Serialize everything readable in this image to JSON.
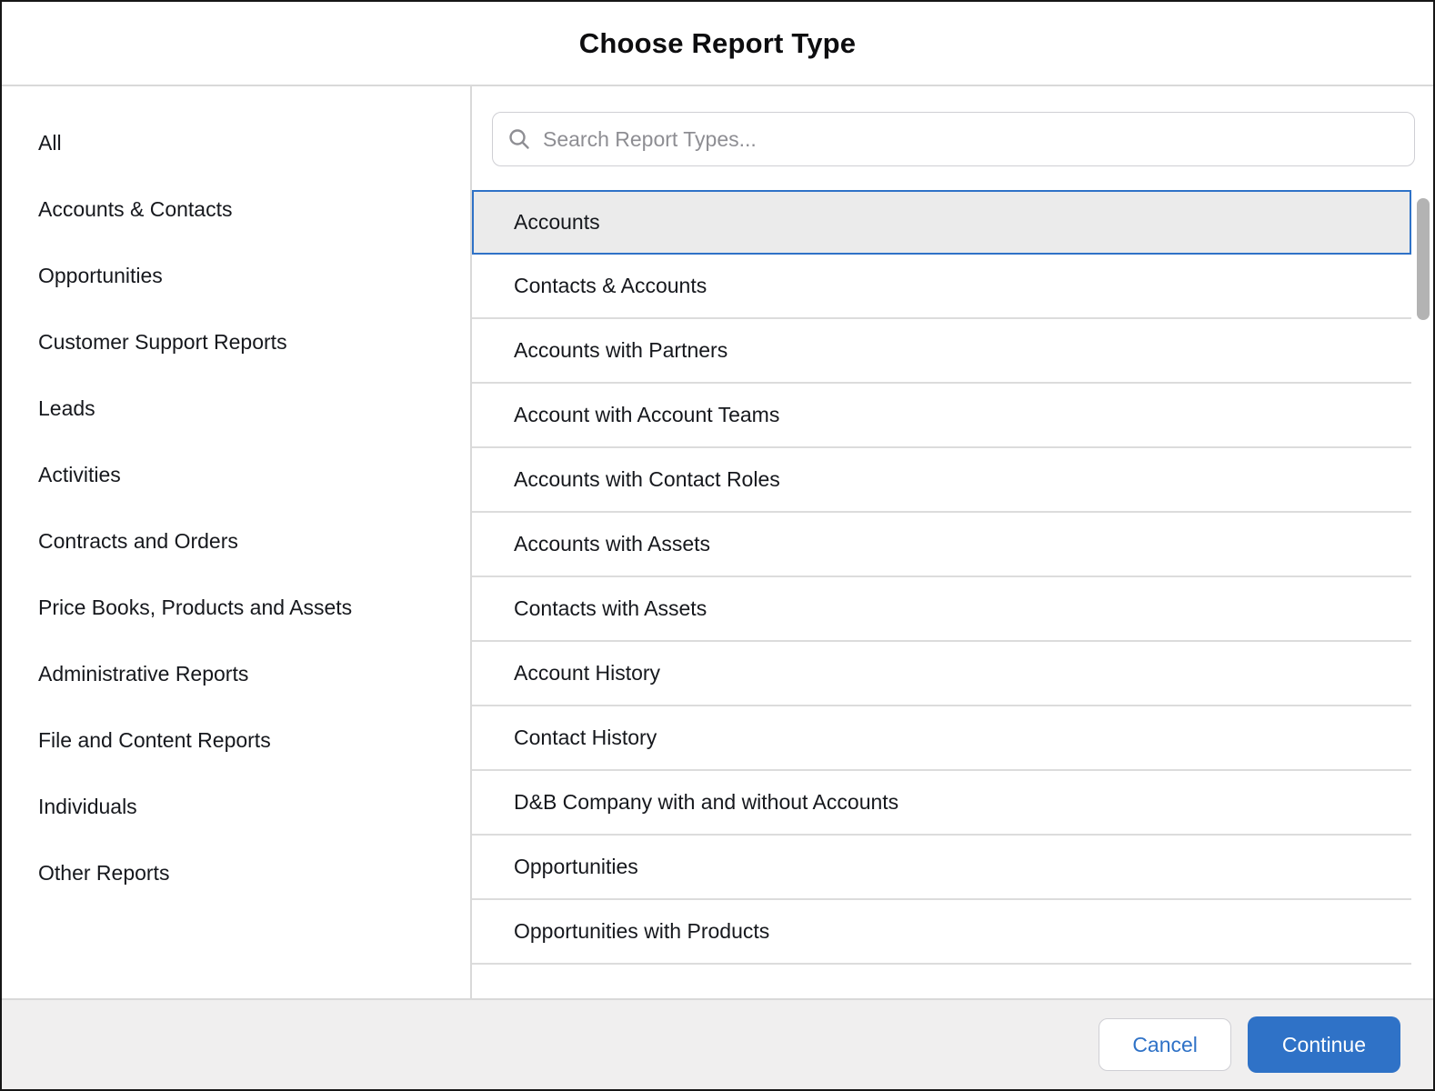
{
  "modal": {
    "title": "Choose Report Type"
  },
  "sidebar": {
    "items": [
      "All",
      "Accounts & Contacts",
      "Opportunities",
      "Customer Support Reports",
      "Leads",
      "Activities",
      "Contracts and Orders",
      "Price Books, Products and Assets",
      "Administrative Reports",
      "File and Content Reports",
      "Individuals",
      "Other Reports"
    ]
  },
  "search": {
    "placeholder": "Search Report Types...",
    "icon": "search-icon",
    "value": ""
  },
  "report_list": {
    "selected_index": 0,
    "items": [
      "Accounts",
      "Contacts & Accounts",
      "Accounts with Partners",
      "Account with Account Teams",
      "Accounts with Contact Roles",
      "Accounts with Assets",
      "Contacts with Assets",
      "Account History",
      "Contact History",
      "D&B Company with and without Accounts",
      "Opportunities",
      "Opportunities with Products"
    ]
  },
  "footer": {
    "cancel_label": "Cancel",
    "continue_label": "Continue"
  },
  "colors": {
    "accent_blue": "#2f72c7",
    "selected_row_bg": "#ebebeb",
    "row_divider": "#dcdcdc",
    "panel_divider": "#d9d9d9",
    "footer_bg": "#f0efef",
    "text": "#16181d",
    "placeholder_gray": "#8e8e93",
    "scrollbar_thumb": "#b3b3b3"
  }
}
